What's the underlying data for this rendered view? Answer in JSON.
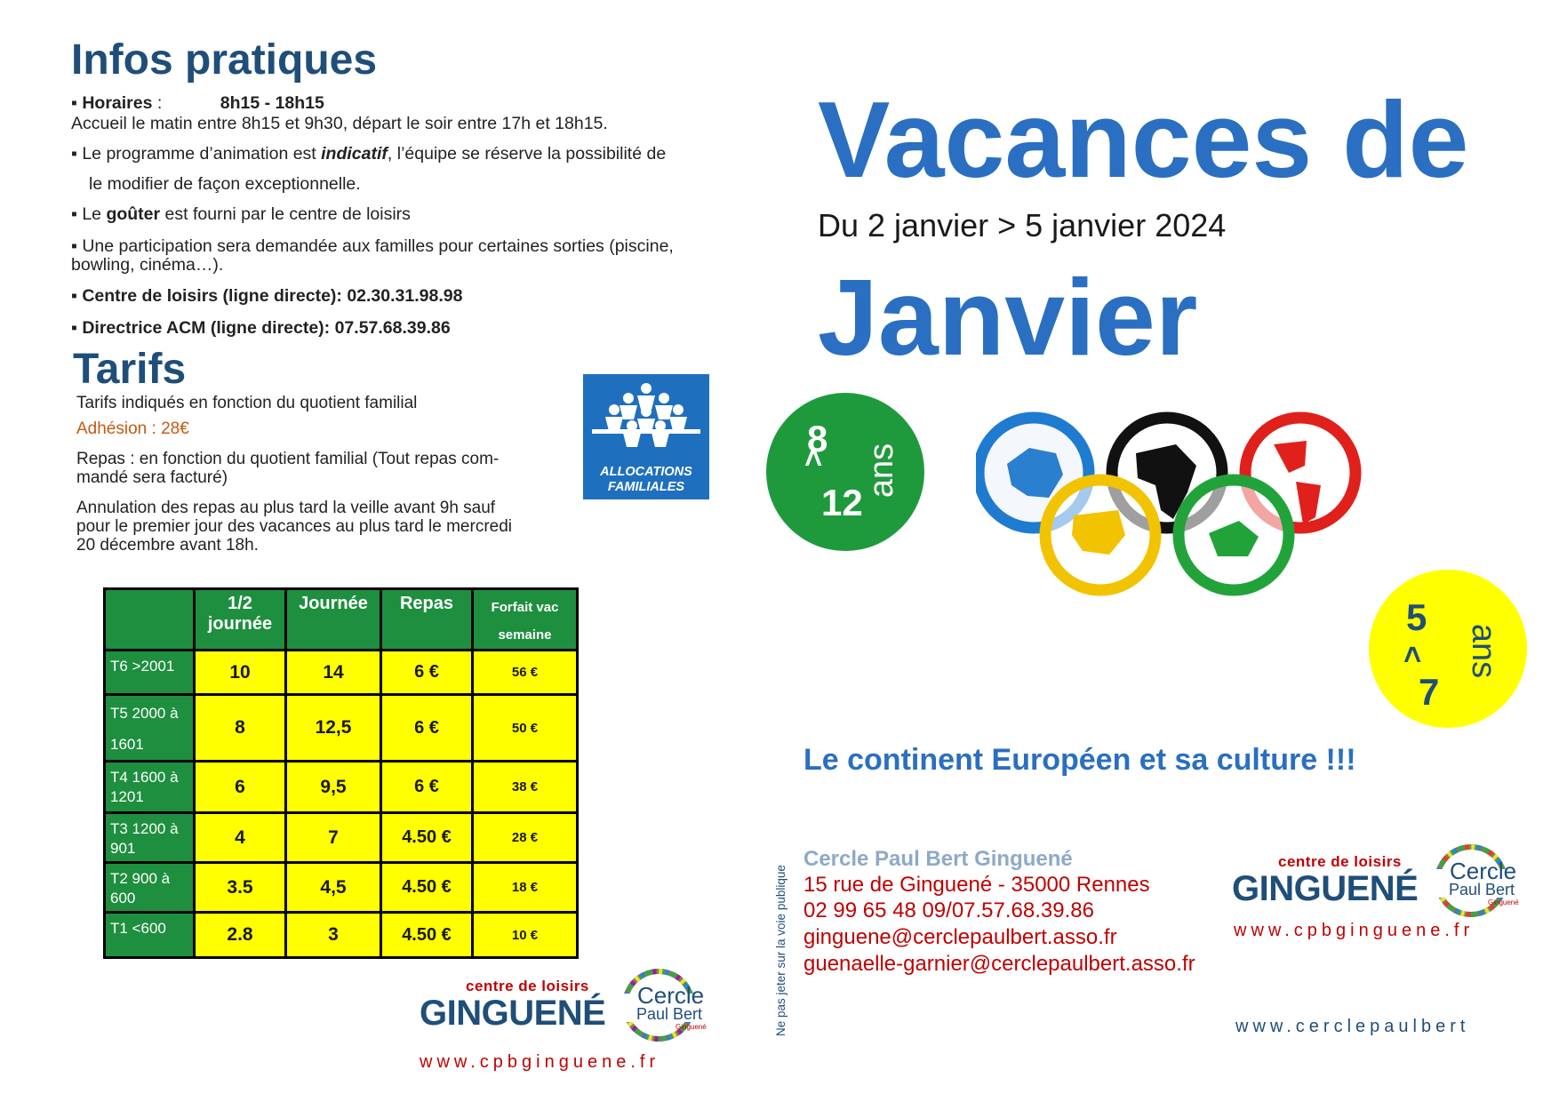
{
  "infos": {
    "title": "Infos pratiques",
    "horaires_label": "▪ Horaires",
    "horaires_colon": " :",
    "horaires_value": "8h15 - 18h15",
    "accueil": "Accueil le matin entre 8h15 et 9h30, départ le soir entre 17h et 18h15.",
    "programme_a": "▪ Le programme d’animation est ",
    "programme_b": "indicatif",
    "programme_c": ", l’équipe se réserve la possibilité de",
    "programme_d": "le modifier de façon exceptionnelle.",
    "gouter_a": "▪ Le ",
    "gouter_b": "goûter",
    "gouter_c": " est fourni par le centre de loisirs",
    "participation_1": "▪ Une participation sera demandée aux familles pour certaines sorties (piscine,",
    "participation_2": "bowling, cinéma…).",
    "centre": "▪ Centre de loisirs (ligne directe): 02.30.31.98.98",
    "directrice": "▪ Directrice ACM (ligne directe): 07.57.68.39.86"
  },
  "tarifs": {
    "title": "Tarifs",
    "intro": "Tarifs indiqués en fonction du quotient familial",
    "adhesion": "Adhésion : 28€",
    "repas_1": "Repas : en fonction du quotient familial (Tout repas com-",
    "repas_2": "mandé sera facturé)",
    "annulation_1": "Annulation des repas au plus tard la veille avant 9h sauf",
    "annulation_2": "pour le premier jour des vacances au plus tard le mercredi",
    "annulation_3": "20 décembre avant 18h.",
    "table": {
      "headers": [
        "",
        "1/2 journée",
        "Journée",
        "Repas",
        "Forfait vac semaine"
      ],
      "header_lines": {
        "demi_1": "1/2",
        "demi_2": "journée",
        "forfait_1": "Forfait vac",
        "forfait_2": "semaine"
      },
      "rows": [
        {
          "label_1": "T6 >2001",
          "label_2": "",
          "demi": "10",
          "journee": "14",
          "repas": "6 €",
          "forfait": "56 €"
        },
        {
          "label_1": "T5 2000 à",
          "label_2": "1601",
          "demi": "8",
          "journee": "12,5",
          "repas": "6 €",
          "forfait": "50 €"
        },
        {
          "label_1": "T4 1600 à",
          "label_2": "1201",
          "demi": "6",
          "journee": "9,5",
          "repas": "6 €",
          "forfait": "38 €"
        },
        {
          "label_1": "T3 1200 à",
          "label_2": "901",
          "demi": "4",
          "journee": "7",
          "repas": "4.50 €",
          "forfait": "28 €"
        },
        {
          "label_1": "T2 900 à",
          "label_2": "600",
          "demi": "3.5",
          "journee": "4,5",
          "repas": "4.50 €",
          "forfait": "18 €"
        },
        {
          "label_1": "T1 <600",
          "label_2": "",
          "demi": "2.8",
          "journee": "3",
          "repas": "4.50 €",
          "forfait": "10 €"
        }
      ]
    }
  },
  "caf_logo": {
    "line1": "ALLOCATIONS",
    "line2": "FAMILIALES"
  },
  "hero": {
    "title_1": "Vacances de",
    "dates": "Du  2 janvier > 5 janvier 2024",
    "title_2": "Janvier",
    "theme": "Le continent Européen et sa culture !!!"
  },
  "age_badges": {
    "older": {
      "from": "8",
      "sep": ">",
      "to": "12",
      "unit": "ans"
    },
    "younger": {
      "from": "5",
      "sep": ">",
      "to": "7",
      "unit": "ans"
    }
  },
  "contact": {
    "vertical_note": "Ne pas jeter sur la voie publique",
    "name": "Cercle Paul Bert Ginguené",
    "address": "15 rue de Ginguené - 35000 Rennes",
    "phones": "02 99 65 48 09/07.57.68.39.86",
    "email_1": "ginguene@cerclepaulbert.asso.fr",
    "email_2": "guenaelle-garnier@cerclepaulbert.asso.fr"
  },
  "logos": {
    "centre_de_loisirs": "centre de loisirs",
    "ginguene": "GINGUENÉ",
    "cercle": "Cercle",
    "paul_bert": "Paul Bert",
    "ginguene_small": "Ginguené",
    "website": "www.cpbginguene.fr",
    "website_2": "www.cerclepaulbert"
  },
  "colors": {
    "navy": "#1f4e79",
    "hero_blue": "#2a6fc1",
    "green": "#1e8f3f",
    "yellow": "#ffff00",
    "red": "#c00000"
  }
}
